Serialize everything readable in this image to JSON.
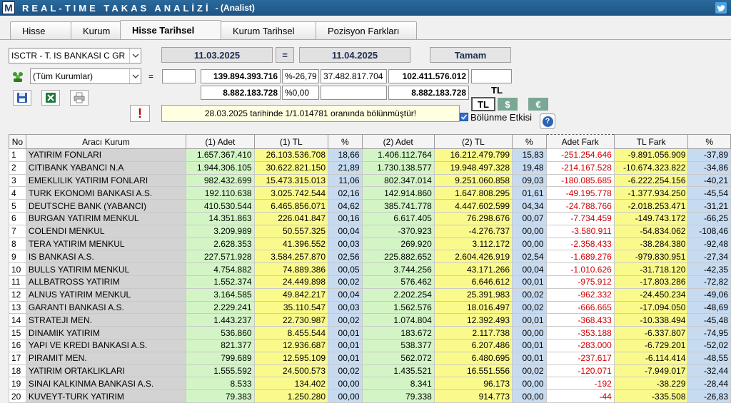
{
  "app": {
    "logo": "M",
    "title": "REAL-TIME TAKAS ANALİZİ",
    "subtitle": "- (Analist)",
    "corner_icon": "twitter-icon"
  },
  "tabs": [
    {
      "label": "Hisse",
      "active": false
    },
    {
      "label": "Kurum",
      "active": false
    },
    {
      "label": "Hisse Tarihsel",
      "active": true
    },
    {
      "label": "Kurum Tarihsel",
      "active": false
    },
    {
      "label": "Pozisyon Farkları",
      "active": false
    }
  ],
  "controls": {
    "stock_select": "ISCTR - T. IS BANKASI C GR",
    "start_date": "11.03.2025",
    "equals": "=",
    "end_date": "11.04.2025",
    "ok_button": "Tamam",
    "institution_select": "(Tüm Kurumlar)",
    "row1_eq": "=",
    "row1_v1": "139.894.393.716",
    "row1_pct": "%-26,79",
    "row1_v2": "37.482.817.704",
    "row1_v3": "102.411.576.012",
    "row2_v1": "8.882.183.728",
    "row2_pct": "%0,00",
    "row2_v3": "8.882.183.728",
    "currency_label": "TL",
    "currency_tl": "TL",
    "currency_usd": "$",
    "currency_eur": "€",
    "split_checkbox_label": "Bölünme Etkisi",
    "split_note": "28.03.2025 tarihinde 1/1.014781 oranında bölünmüştür!",
    "warning_mark": "!",
    "help_mark": "?"
  },
  "colors": {
    "title_bar": "#1f5485",
    "green_col": "#d3f5c6",
    "yellow_col": "#fafa8c",
    "blue_col": "#c7dbf0",
    "negative": "#d40000"
  },
  "table": {
    "headers": [
      "No",
      "Aracı Kurum",
      "(1) Adet",
      "(1) TL",
      "%",
      "(2) Adet",
      "(2) TL",
      "%",
      "Adet Fark",
      "TL Fark",
      "%"
    ],
    "rows": [
      [
        "1",
        "YATIRIM FONLARI",
        "1.657.367.410",
        "26.103.536.708",
        "18,66",
        "1.406.112.764",
        "16.212.479.799",
        "15,83",
        "-251.254.646",
        "-9.891.056.909",
        "-37,89"
      ],
      [
        "2",
        "CITIBANK YABANCI N.A",
        "1.944.306.105",
        "30.622.821.150",
        "21,89",
        "1.730.138.577",
        "19.948.497.328",
        "19,48",
        "-214.167.528",
        "-10.674.323.822",
        "-34,86"
      ],
      [
        "3",
        "EMEKLILIK YATIRIM FONLARI",
        "982.432.699",
        "15.473.315.013",
        "11,06",
        "802.347.014",
        "9.251.060.858",
        "09,03",
        "-180.085.685",
        "-6.222.254.156",
        "-40,21"
      ],
      [
        "4",
        "TURK EKONOMI BANKASI A.S.",
        "192.110.638",
        "3.025.742.544",
        "02,16",
        "142.914.860",
        "1.647.808.295",
        "01,61",
        "-49.195.778",
        "-1.377.934.250",
        "-45,54"
      ],
      [
        "5",
        "DEUTSCHE BANK (YABANCI)",
        "410.530.544",
        "6.465.856.071",
        "04,62",
        "385.741.778",
        "4.447.602.599",
        "04,34",
        "-24.788.766",
        "-2.018.253.471",
        "-31,21"
      ],
      [
        "6",
        "BURGAN YATIRIM MENKUL",
        "14.351.863",
        "226.041.847",
        "00,16",
        "6.617.405",
        "76.298.676",
        "00,07",
        "-7.734.459",
        "-149.743.172",
        "-66,25"
      ],
      [
        "7",
        "COLENDI MENKUL",
        "3.209.989",
        "50.557.325",
        "00,04",
        "-370.923",
        "-4.276.737",
        "00,00",
        "-3.580.911",
        "-54.834.062",
        "-108,46"
      ],
      [
        "8",
        "TERA YATIRIM MENKUL",
        "2.628.353",
        "41.396.552",
        "00,03",
        "269.920",
        "3.112.172",
        "00,00",
        "-2.358.433",
        "-38.284.380",
        "-92,48"
      ],
      [
        "9",
        "IS BANKASI A.S.",
        "227.571.928",
        "3.584.257.870",
        "02,56",
        "225.882.652",
        "2.604.426.919",
        "02,54",
        "-1.689.276",
        "-979.830.951",
        "-27,34"
      ],
      [
        "10",
        "BULLS YATIRIM MENKUL",
        "4.754.882",
        "74.889.386",
        "00,05",
        "3.744.256",
        "43.171.266",
        "00,04",
        "-1.010.626",
        "-31.718.120",
        "-42,35"
      ],
      [
        "11",
        "ALLBATROSS YATIRIM",
        "1.552.374",
        "24.449.898",
        "00,02",
        "576.462",
        "6.646.612",
        "00,01",
        "-975.912",
        "-17.803.286",
        "-72,82"
      ],
      [
        "12",
        "ALNUS YATIRIM MENKUL",
        "3.164.585",
        "49.842.217",
        "00,04",
        "2.202.254",
        "25.391.983",
        "00,02",
        "-962.332",
        "-24.450.234",
        "-49,06"
      ],
      [
        "13",
        "GARANTI BANKASI A.S.",
        "2.229.241",
        "35.110.547",
        "00,03",
        "1.562.576",
        "18.016.497",
        "00,02",
        "-666.665",
        "-17.094.050",
        "-48,69"
      ],
      [
        "14",
        "STRATEJI MEN.",
        "1.443.237",
        "22.730.987",
        "00,02",
        "1.074.804",
        "12.392.493",
        "00,01",
        "-368.433",
        "-10.338.494",
        "-45,48"
      ],
      [
        "15",
        "DINAMIK YATIRIM",
        "536.860",
        "8.455.544",
        "00,01",
        "183.672",
        "2.117.738",
        "00,00",
        "-353.188",
        "-6.337.807",
        "-74,95"
      ],
      [
        "16",
        "YAPI VE KREDI BANKASI A.S.",
        "821.377",
        "12.936.687",
        "00,01",
        "538.377",
        "6.207.486",
        "00,01",
        "-283.000",
        "-6.729.201",
        "-52,02"
      ],
      [
        "17",
        "PIRAMIT MEN.",
        "799.689",
        "12.595.109",
        "00,01",
        "562.072",
        "6.480.695",
        "00,01",
        "-237.617",
        "-6.114.414",
        "-48,55"
      ],
      [
        "18",
        "YATIRIM ORTAKLIKLARI",
        "1.555.592",
        "24.500.573",
        "00,02",
        "1.435.521",
        "16.551.556",
        "00,02",
        "-120.071",
        "-7.949.017",
        "-32,44"
      ],
      [
        "19",
        "SINAI KALKINMA BANKASI A.S.",
        "8.533",
        "134.402",
        "00,00",
        "8.341",
        "96.173",
        "00,00",
        "-192",
        "-38.229",
        "-28,44"
      ],
      [
        "20",
        "KUVEYT-TURK YATIRIM",
        "79.383",
        "1.250.280",
        "00,00",
        "79.338",
        "914.773",
        "00,00",
        "-44",
        "-335.508",
        "-26,83"
      ]
    ]
  }
}
